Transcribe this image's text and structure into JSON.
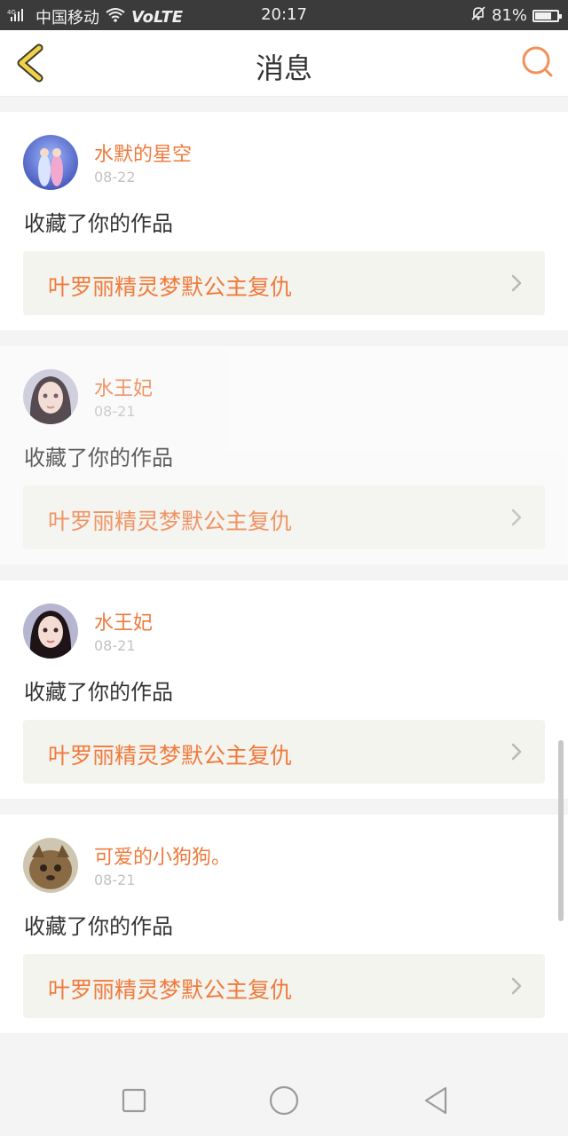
{
  "status_bar": {
    "signal_label": "4G",
    "carrier": "中国移动",
    "volte": "VoLTE",
    "time": "20:17",
    "battery": "81%",
    "battery_level": 0.81
  },
  "header": {
    "title": "消息",
    "back_icon": "chevron-left-icon",
    "search_icon": "search-icon"
  },
  "accent_color": "#f07a3c",
  "messages": [
    {
      "username": "水默的星空",
      "date": "08-22",
      "action": "收藏了你的作品",
      "work_title": "叶罗丽精灵梦默公主复仇"
    },
    {
      "username": "水王妃",
      "date": "08-21",
      "action": "收藏了你的作品",
      "work_title": "叶罗丽精灵梦默公主复仇"
    },
    {
      "username": "水王妃",
      "date": "08-21",
      "action": "收藏了你的作品",
      "work_title": "叶罗丽精灵梦默公主复仇"
    },
    {
      "username": "可爱的小狗狗。",
      "date": "08-21",
      "action": "收藏了你的作品",
      "work_title": "叶罗丽精灵梦默公主复仇"
    }
  ],
  "system_nav": {
    "square_icon": "recent-apps-icon",
    "circle_icon": "home-icon",
    "triangle_icon": "back-triangle-icon"
  }
}
